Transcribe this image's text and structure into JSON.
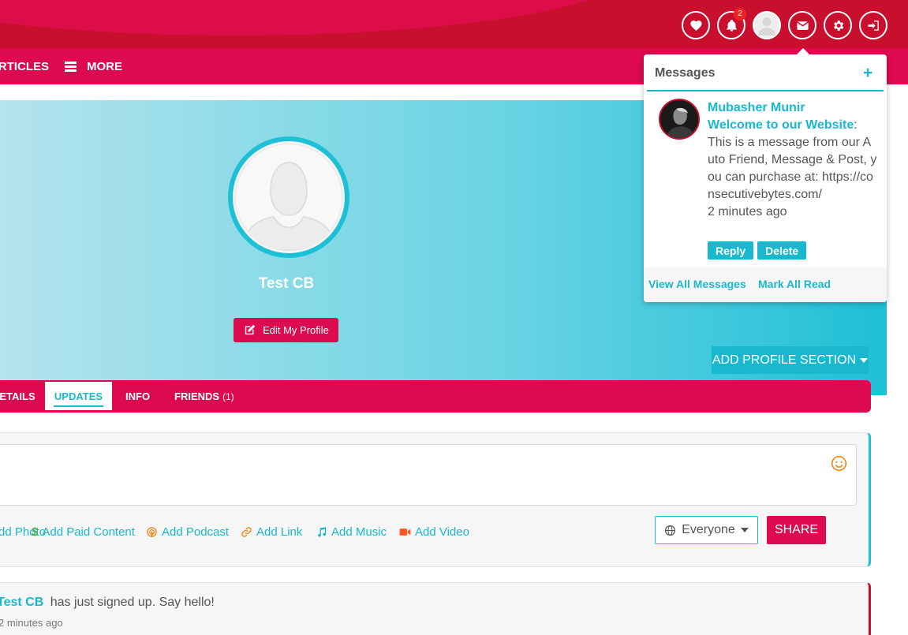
{
  "header": {
    "notification_count": "2",
    "icons": [
      "heart-icon",
      "bell-icon",
      "avatar",
      "envelope-icon",
      "gear-icon",
      "sign-in-icon"
    ]
  },
  "nav": {
    "articles_label": "ARTICLES",
    "more_label": "MORE"
  },
  "profile": {
    "name": "Test CB",
    "edit_label": "Edit My Profile",
    "add_section_label": "ADD PROFILE SECTION"
  },
  "tabs": {
    "details": "DETAILS",
    "updates": "UPDATES",
    "info": "INFO",
    "friends": "FRIENDS",
    "friends_count": "(1)"
  },
  "composer": {
    "attachments": {
      "photo": "Add Photo",
      "paid": "Add Paid Content",
      "podcast": "Add Podcast",
      "link": "Add Link",
      "music": "Add Music",
      "video": "Add Video"
    },
    "privacy": "Everyone",
    "share_label": "SHARE"
  },
  "activity": {
    "user": "Test CB",
    "text": "has just signed up. Say hello!",
    "time": "2 minutes ago"
  },
  "messages": {
    "title": "Messages",
    "add_symbol": "+",
    "items": [
      {
        "sender": "Mubasher Munir",
        "subject": "Welcome to our Website",
        "separator": ":",
        "body": "This is a message from our Auto Friend, Message & Post, you can purchase at: https://consecutivebytes.com/",
        "time": "2 minutes ago",
        "reply_label": "Reply",
        "delete_label": "Delete"
      }
    ],
    "view_all_label": "View All Messages",
    "mark_all_read_label": "Mark All Read"
  },
  "colors": {
    "brand_red": "#dd0a4f",
    "dark_red": "#c8102e",
    "accent_cyan": "#1ab8cf"
  }
}
